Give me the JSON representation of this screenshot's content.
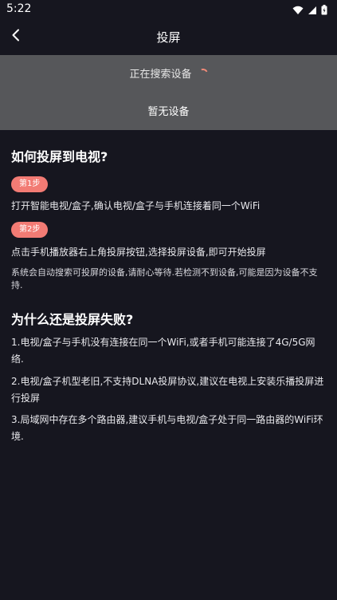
{
  "status_bar": {
    "time": "5:22"
  },
  "header": {
    "title": "投屏"
  },
  "devices": {
    "searching_label": "正在搜索设备",
    "empty_label": "暂无设备"
  },
  "help": {
    "how_title": "如何投屏到电视?",
    "steps": [
      {
        "badge": "第1步",
        "text": "打开智能电视/盒子,确认电视/盒子与手机连接着同一个WiFi"
      },
      {
        "badge": "第2步",
        "text": "点击手机播放器右上角投屏按钮,选择投屏设备,即可开始投屏"
      }
    ],
    "note": "系统会自动搜索可投屏的设备,请耐心等待.若检测不到设备,可能是因为设备不支持.",
    "why_title": "为什么还是投屏失败?",
    "reasons": [
      "1.电视/盒子与手机没有连接在同一个WiFi,或者手机可能连接了4G/5G网络.",
      "2.电视/盒子机型老旧,不支持DLNA投屏协议,建议在电视上安装乐播投屏进行投屏",
      "3.局域网中存在多个路由器,建议手机与电视/盒子处于同一路由器的WiFi环境."
    ]
  },
  "colors": {
    "background": "#16161f",
    "panel": "#56575a",
    "badge": "#f27b74"
  }
}
